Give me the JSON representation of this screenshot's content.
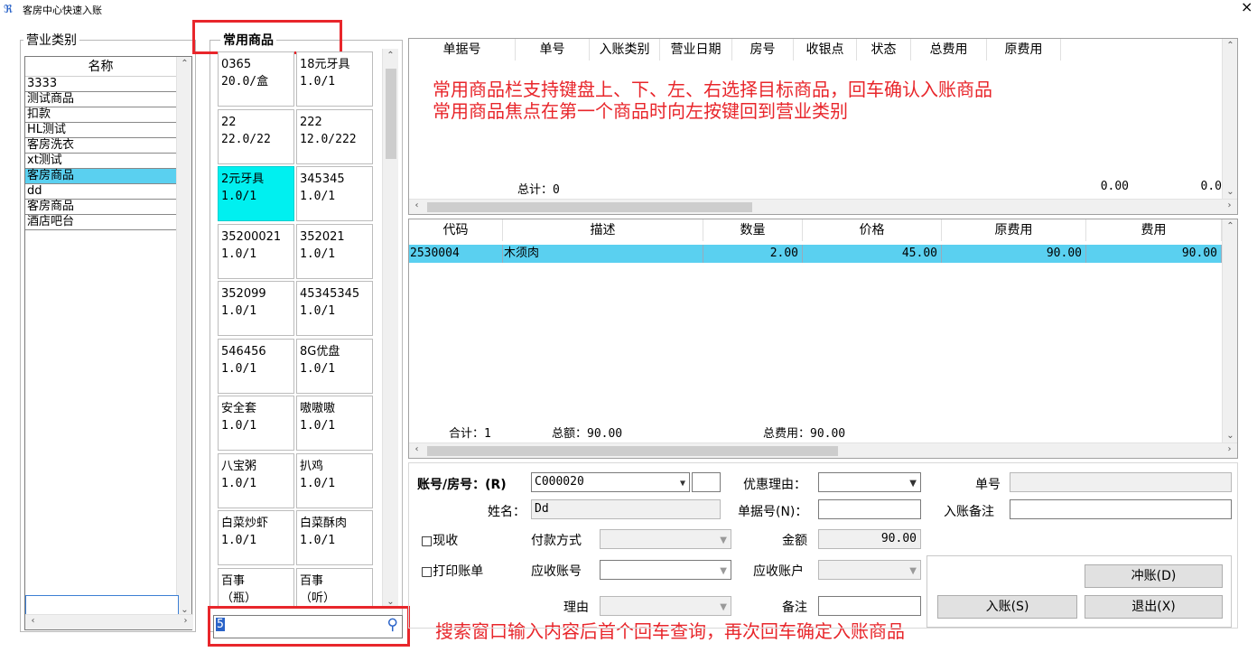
{
  "window": {
    "title": "客房中心快速入账",
    "close": "×"
  },
  "category": {
    "legend": "营业类别",
    "header": "名称",
    "items": [
      "3333",
      "测试商品",
      "扣款",
      "HL测试",
      "客房洗衣",
      "xt测试",
      "客房商品",
      "dd",
      "客房商品",
      "酒店吧台"
    ],
    "selected_index": 6
  },
  "common": {
    "legend": "常用商品",
    "tiles": [
      [
        "0365",
        "20.0/盒"
      ],
      [
        "18元牙具",
        "1.0/1"
      ],
      [
        "22",
        "22.0/22"
      ],
      [
        "222",
        "12.0/222"
      ],
      [
        "2元牙具",
        "1.0/1"
      ],
      [
        "345345",
        "1.0/1"
      ],
      [
        "35200021",
        "1.0/1"
      ],
      [
        "352021",
        "1.0/1"
      ],
      [
        "352099",
        "1.0/1"
      ],
      [
        "45345345",
        "1.0/1"
      ],
      [
        "546456",
        "1.0/1"
      ],
      [
        "8G优盘",
        "1.0/1"
      ],
      [
        "安全套",
        "1.0/1"
      ],
      [
        "嗷嗷嗷",
        "1.0/1"
      ],
      [
        "八宝粥",
        "1.0/1"
      ],
      [
        "扒鸡",
        "1.0/1"
      ],
      [
        "白菜炒虾",
        "1.0/1"
      ],
      [
        "白菜酥肉",
        "1.0/1"
      ],
      [
        "百事",
        "（瓶）"
      ],
      [
        "百事",
        "（听）"
      ]
    ],
    "selected_index": 4,
    "search_value": "5"
  },
  "bills": {
    "columns": [
      "单据号",
      "单号",
      "入账类别",
      "营业日期",
      "房号",
      "收银点",
      "状态",
      "总费用",
      "原费用"
    ],
    "total_label": "总计：0",
    "total_fee": "0.00",
    "total_orig": "0.0"
  },
  "detail": {
    "columns": [
      "代码",
      "描述",
      "数量",
      "价格",
      "原费用",
      "费用"
    ],
    "rows": [
      [
        "2530004",
        "木须肉",
        "2.00",
        "45.00",
        "90.00",
        "90.00"
      ]
    ],
    "footer_count": "合计：1",
    "footer_amount": "总额：90.00",
    "footer_fee": "总费用：90.00"
  },
  "annotations": {
    "line1": "常用商品栏支持键盘上、下、左、右选择目标商品，回车确认入账商品",
    "line2": "常用商品焦点在第一个商品时向左按键回到营业类别",
    "search": "搜索窗口输入内容后首个回车查询，再次回车确定入账商品"
  },
  "form": {
    "account_label": "账号/房号：(R)",
    "account_value": "C000020",
    "discount_label": "优惠理由：",
    "order_label": "单号",
    "name_label": "姓名：",
    "name_value": "Dd",
    "bill_no_label": "单据号(N)：",
    "remark_label": "入账备注",
    "cash_label": "□现收",
    "pay_method_label": "付款方式",
    "amount_label": "金额",
    "amount_value": "90.00",
    "print_label": "□打印账单",
    "recv_acct_label": "应收账号",
    "recv_user_label": "应收账户",
    "reason_label": "理由",
    "note_label": "备注",
    "reverse_button": "冲账(D)",
    "post_button": "入账(S)",
    "exit_button": "退出(X)"
  },
  "colors": {
    "accent_select": "#5ad0f0",
    "tile_select": "#00f0f0",
    "annotation": "#e8262b"
  }
}
